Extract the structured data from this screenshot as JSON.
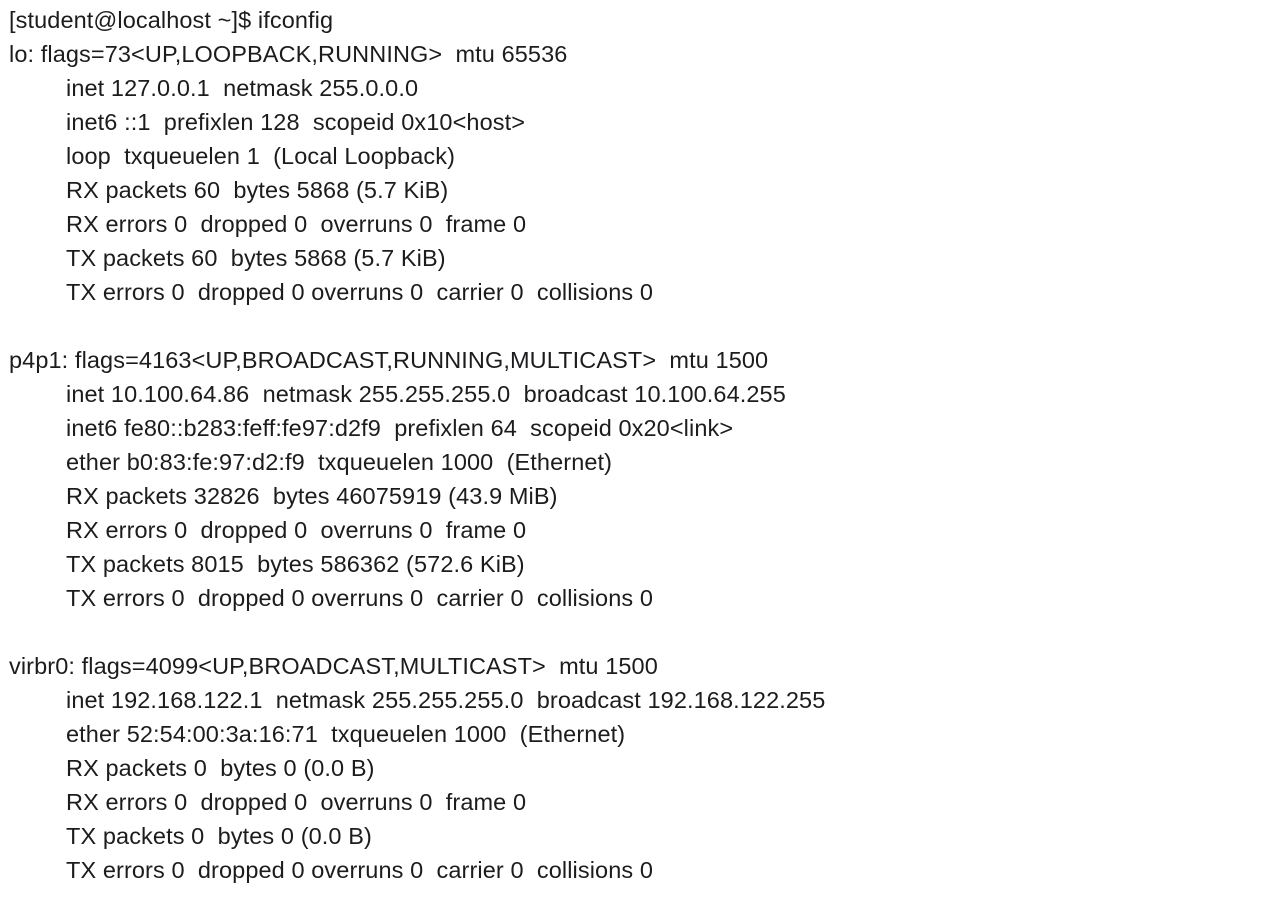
{
  "terminal": {
    "prompt": "[student@localhost ~]$ ifconfig",
    "interfaces": [
      {
        "header": "lo: flags=73<UP,LOOPBACK,RUNNING>  mtu 65536",
        "lines": [
          "inet 127.0.0.1  netmask 255.0.0.0",
          "inet6 ::1  prefixlen 128  scopeid 0x10<host>",
          "loop  txqueuelen 1  (Local Loopback)",
          "RX packets 60  bytes 5868 (5.7 KiB)",
          "RX errors 0  dropped 0  overruns 0  frame 0",
          "TX packets 60  bytes 5868 (5.7 KiB)",
          "TX errors 0  dropped 0 overruns 0  carrier 0  collisions 0"
        ]
      },
      {
        "header": "p4p1: flags=4163<UP,BROADCAST,RUNNING,MULTICAST>  mtu 1500",
        "lines": [
          "inet 10.100.64.86  netmask 255.255.255.0  broadcast 10.100.64.255",
          "inet6 fe80::b283:feff:fe97:d2f9  prefixlen 64  scopeid 0x20<link>",
          "ether b0:83:fe:97:d2:f9  txqueuelen 1000  (Ethernet)",
          "RX packets 32826  bytes 46075919 (43.9 MiB)",
          "RX errors 0  dropped 0  overruns 0  frame 0",
          "TX packets 8015  bytes 586362 (572.6 KiB)",
          "TX errors 0  dropped 0 overruns 0  carrier 0  collisions 0"
        ]
      },
      {
        "header": "virbr0: flags=4099<UP,BROADCAST,MULTICAST>  mtu 1500",
        "lines": [
          "inet 192.168.122.1  netmask 255.255.255.0  broadcast 192.168.122.255",
          "ether 52:54:00:3a:16:71  txqueuelen 1000  (Ethernet)",
          "RX packets 0  bytes 0 (0.0 B)",
          "RX errors 0  dropped 0  overruns 0  frame 0",
          "TX packets 0  bytes 0 (0.0 B)",
          "TX errors 0  dropped 0 overruns 0  carrier 0  collisions 0"
        ]
      }
    ]
  }
}
